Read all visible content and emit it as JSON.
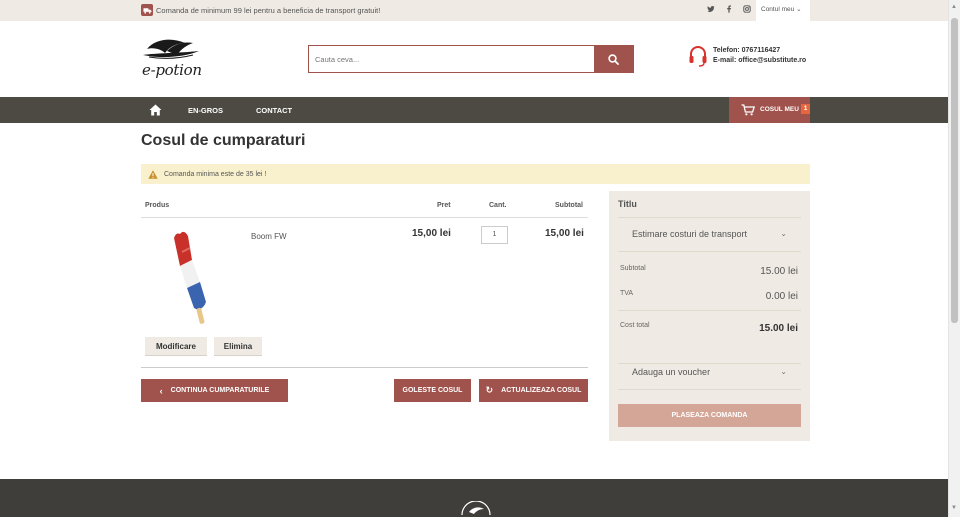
{
  "topbar": {
    "notice": "Comanda de minimum 99 lei pentru a beneficia de transport gratuit!",
    "social": [
      "twitter-icon",
      "facebook-icon",
      "instagram-icon"
    ],
    "account": "Contul meu"
  },
  "header": {
    "logo_text": "e-potion",
    "search_placeholder": "Cauta ceva...",
    "phone": "Telefon: 0767116427",
    "email": "E-mail: office@substitute.ro"
  },
  "nav": {
    "items": [
      {
        "label": "EN-GROS"
      },
      {
        "label": "CONTACT"
      }
    ],
    "cart_label": "COSUL MEU",
    "cart_count": "1"
  },
  "page": {
    "title": "Cosul de cumparaturi",
    "warning": "Comanda minima este de 35 lei !"
  },
  "table": {
    "headers": {
      "product": "Produs",
      "price": "Pret",
      "qty": "Cant.",
      "subtotal": "Subtotal"
    },
    "rows": [
      {
        "name": "Boom FW",
        "price": "15,00 lei",
        "qty": "1",
        "subtotal": "15,00 lei",
        "edit": "Modificare",
        "remove": "Elimina"
      }
    ]
  },
  "actions": {
    "continue": "CONTINUA CUMPARATURILE",
    "clear": "GOLESTE COSUL",
    "update": "ACTUALIZEAZA COSUL"
  },
  "summary": {
    "title": "Titlu",
    "shipping_estimate": "Estimare costuri de transport",
    "subtotal_label": "Subtotal",
    "subtotal_value": "15.00 lei",
    "tva_label": "TVA",
    "tva_value": "0.00 lei",
    "total_label": "Cost total",
    "total_value": "15.00 lei",
    "voucher": "Adauga un voucher",
    "place_order": "PLASEAZA COMANDA"
  },
  "colors": {
    "accent": "#a0524c",
    "nav_bg": "#4c4a43",
    "beige": "#efebe4",
    "warning_bg": "#f9f1cd",
    "badge": "#e6673e"
  }
}
